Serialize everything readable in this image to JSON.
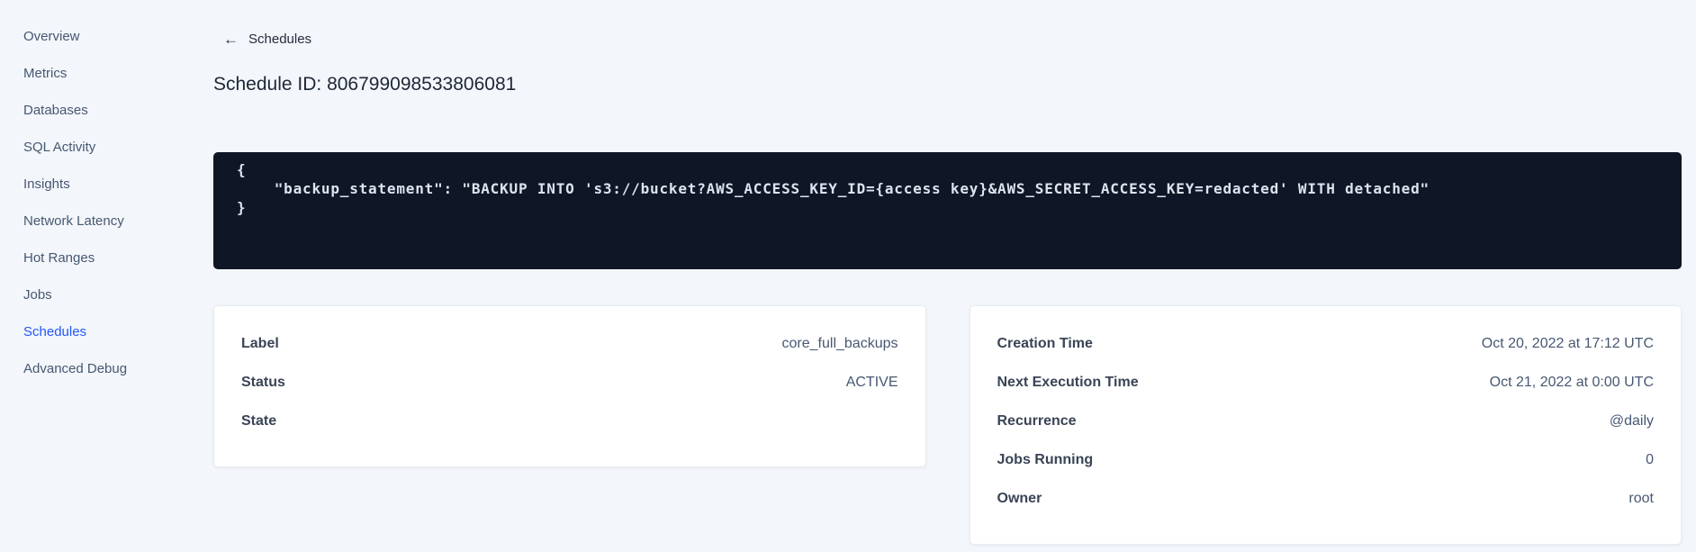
{
  "sidebar": {
    "items": [
      {
        "label": "Overview",
        "active": false
      },
      {
        "label": "Metrics",
        "active": false
      },
      {
        "label": "Databases",
        "active": false
      },
      {
        "label": "SQL Activity",
        "active": false
      },
      {
        "label": "Insights",
        "active": false
      },
      {
        "label": "Network Latency",
        "active": false
      },
      {
        "label": "Hot Ranges",
        "active": false
      },
      {
        "label": "Jobs",
        "active": false
      },
      {
        "label": "Schedules",
        "active": true
      },
      {
        "label": "Advanced Debug",
        "active": false
      }
    ]
  },
  "header": {
    "back_arrow": "←",
    "back_label": "Schedules",
    "title": "Schedule ID: 806799098533806081"
  },
  "code": {
    "lines": [
      "{",
      "    \"backup_statement\": \"BACKUP INTO 's3://bucket?AWS_ACCESS_KEY_ID={access key}&AWS_SECRET_ACCESS_KEY=redacted' WITH detached\"",
      "}"
    ]
  },
  "details_left": {
    "rows": [
      {
        "label": "Label",
        "value": "core_full_backups"
      },
      {
        "label": "Status",
        "value": "ACTIVE"
      },
      {
        "label": "State",
        "value": ""
      }
    ]
  },
  "details_right": {
    "rows": [
      {
        "label": "Creation Time",
        "value": "Oct 20, 2022 at 17:12 UTC"
      },
      {
        "label": "Next Execution Time",
        "value": "Oct 21, 2022 at 0:00 UTC"
      },
      {
        "label": "Recurrence",
        "value": "@daily"
      },
      {
        "label": "Jobs Running",
        "value": "0"
      },
      {
        "label": "Owner",
        "value": "root"
      }
    ]
  },
  "colors": {
    "accent_blue": "#2458f7",
    "code_background": "#0f1625",
    "code_text": "#dde3ee",
    "page_background": "#f3f6fa",
    "text_primary": "#1e2736",
    "text_secondary": "#475872",
    "card_background": "#ffffff"
  }
}
